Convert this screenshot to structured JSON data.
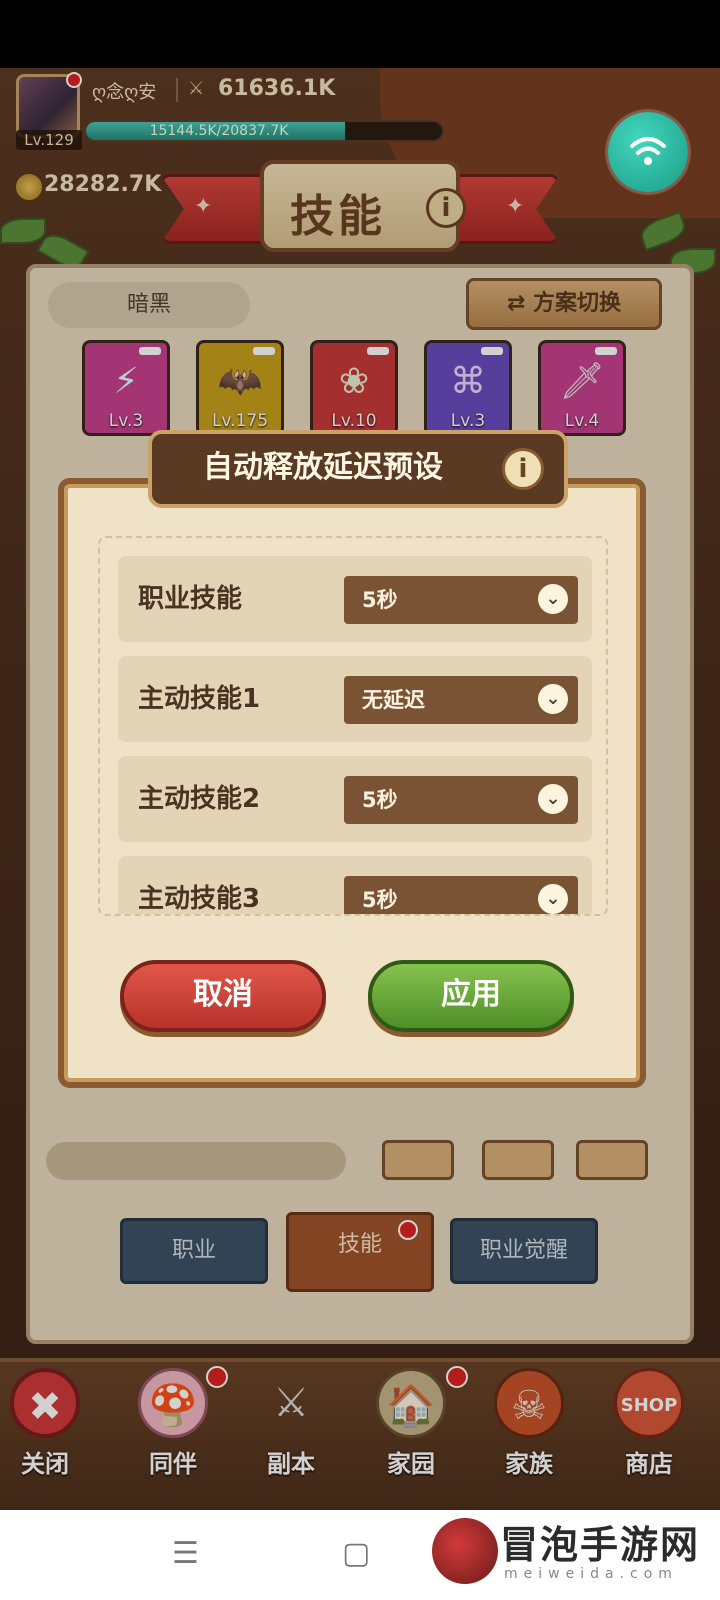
{
  "player": {
    "name": "ღ念ღ安",
    "level": "Lv.129",
    "power": "61636.1K",
    "xp_text": "15144.5K/20837.7K",
    "xp_progress": 0.727,
    "gold": "28282.7K"
  },
  "page_title": "技能",
  "loadout": {
    "name": "暗黑",
    "switch_label": "方案切换",
    "skills": [
      {
        "lv": "Lv.3",
        "icon": "lightning-bird-icon",
        "color": "#c9418f"
      },
      {
        "lv": "Lv.175",
        "icon": "bat-icon",
        "color": "#c8a01c"
      },
      {
        "lv": "Lv.10",
        "icon": "flower-icon",
        "color": "#c93a3a"
      },
      {
        "lv": "Lv.3",
        "icon": "rune-circle-icon",
        "color": "#6a4cc0"
      },
      {
        "lv": "Lv.4",
        "icon": "sword-icon",
        "color": "#c9418f"
      }
    ]
  },
  "modal": {
    "title": "自动释放延迟预设",
    "rows": [
      {
        "label": "职业技能",
        "value": "5秒"
      },
      {
        "label": "主动技能1",
        "value": "无延迟"
      },
      {
        "label": "主动技能2",
        "value": "5秒"
      },
      {
        "label": "主动技能3",
        "value": "5秒"
      }
    ],
    "cancel_label": "取消",
    "apply_label": "应用"
  },
  "tabs": [
    {
      "label": "职业",
      "active": false
    },
    {
      "label": "技能",
      "active": true
    },
    {
      "label": "职业觉醒",
      "active": false
    }
  ],
  "nav": [
    {
      "label": "关闭",
      "icon": "close-icon"
    },
    {
      "label": "同伴",
      "icon": "companions-icon"
    },
    {
      "label": "副本",
      "icon": "crossed-swords-icon"
    },
    {
      "label": "家园",
      "icon": "home-icon"
    },
    {
      "label": "家族",
      "icon": "guild-skull-icon"
    },
    {
      "label": "商店",
      "icon": "shop-icon"
    }
  ],
  "watermark": {
    "brand": "冒泡手游网",
    "sub": "meiweida.com"
  },
  "colors": {
    "accent_teal": "#1a9c86",
    "cancel_red": "#b9332b",
    "apply_green": "#4f8f26"
  }
}
